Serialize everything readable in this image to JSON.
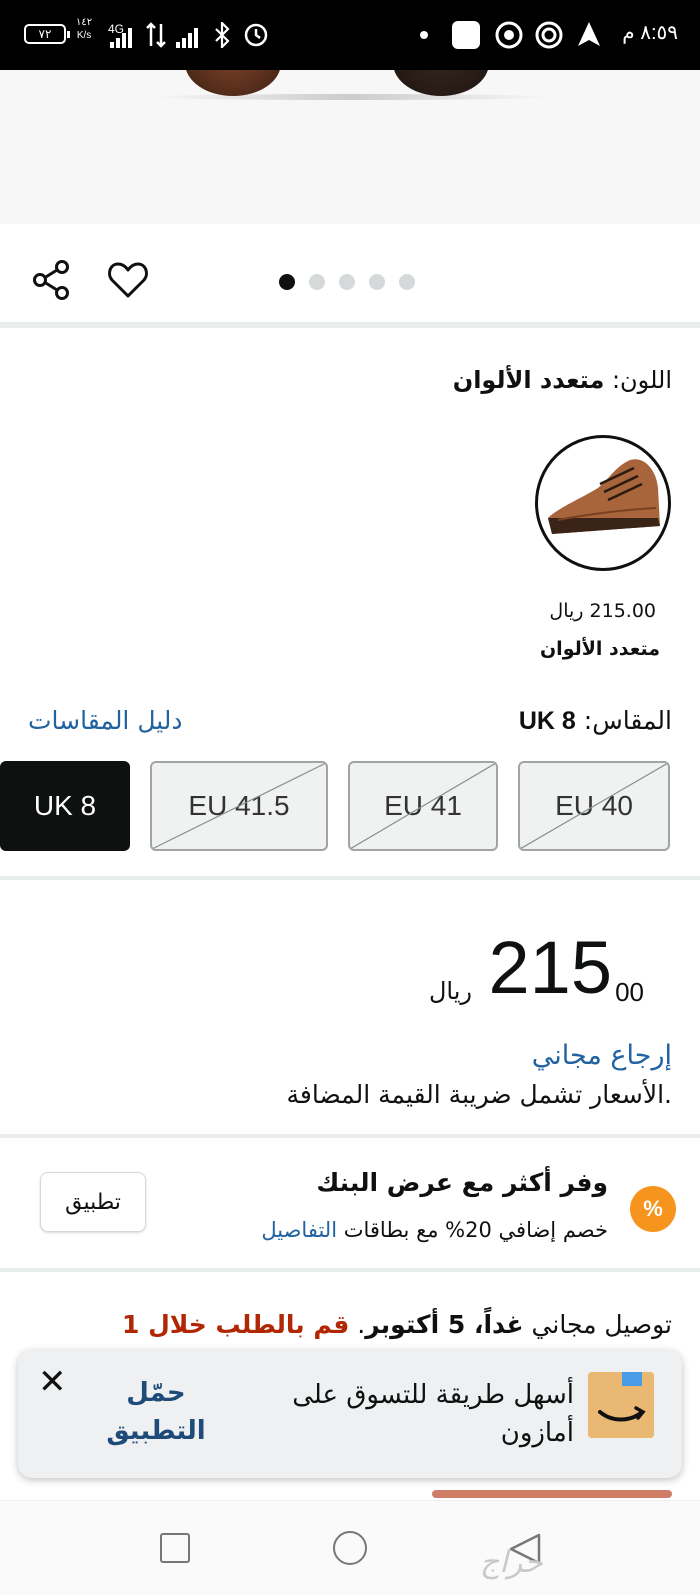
{
  "status_bar": {
    "time": "٨:٥٩ م",
    "battery": "٧٢",
    "network": "4G",
    "speed_value": "١٤٢",
    "speed_unit": "K/s"
  },
  "gallery": {
    "page_count": 5,
    "active_page": 1
  },
  "color": {
    "label": "اللون:",
    "value": "متعدد الألوان",
    "swatch_price": "215.00 ريال",
    "swatch_name": "متعدد الألوان"
  },
  "size": {
    "label": "المقاس:",
    "value": "UK 8",
    "guide_link": "دليل المقاسات",
    "options": [
      {
        "label": "UK 8",
        "selected": true,
        "available": true
      },
      {
        "label": "EU 41.5",
        "selected": false,
        "available": false
      },
      {
        "label": "EU 41",
        "selected": false,
        "available": false
      },
      {
        "label": "EU 40",
        "selected": false,
        "available": false
      }
    ]
  },
  "price": {
    "currency": "ريال",
    "whole": "215",
    "fraction": "00",
    "free_returns": "إرجاع مجاني",
    "vat_note": ".الأسعار تشمل ضريبة القيمة المضافة"
  },
  "bank_offer": {
    "icon": "%",
    "title": "وفر أكثر مع عرض البنك",
    "description": "خصم إضافي 20% مع بطاقات",
    "details_link": "التفاصيل",
    "apply_button": "تطبيق"
  },
  "delivery": {
    "prefix": "توصيل مجاني ",
    "date": "غداً، 5 أكتوبر",
    "separator": ". ",
    "order_within": "قم بالطلب خلال 1"
  },
  "app_banner": {
    "text": "أسهل طريقة للتسوق على أمازون",
    "cta": "حمّل التطبيق",
    "close": "✕"
  },
  "watermark": "حراج"
}
